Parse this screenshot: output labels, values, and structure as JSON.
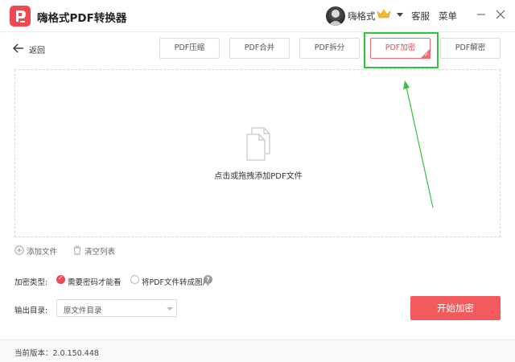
{
  "app": {
    "title": "嗨格式PDF转换器"
  },
  "header": {
    "user_name": "嗨格式",
    "service_label": "客服",
    "menu_label": "菜单",
    "minimize_icon": "minimize-icon",
    "close_icon": "close-icon"
  },
  "toolbar": {
    "back_label": "返回",
    "tabs": [
      {
        "label": "PDF压缩",
        "active": false
      },
      {
        "label": "PDF合并",
        "active": false
      },
      {
        "label": "PDF拆分",
        "active": false
      },
      {
        "label": "PDF加密",
        "active": true
      },
      {
        "label": "PDF解密",
        "active": false
      }
    ]
  },
  "dropzone": {
    "text": "点击或拖拽添加PDF文件"
  },
  "list_actions": {
    "add_file": "添加文件",
    "clear_list": "清空列表"
  },
  "encryption": {
    "label": "加密类型:",
    "options": [
      {
        "label": "需要密码才能看",
        "selected": true
      },
      {
        "label": "将PDF文件转成图片",
        "selected": false
      }
    ],
    "help": "?"
  },
  "output": {
    "label": "输出目录:",
    "value": "原文件目录"
  },
  "start_button": "开始加密",
  "footer": {
    "version": "当前版本：2.0.150.448"
  },
  "colors": {
    "accent": "#f04a50",
    "highlight": "#35c13c",
    "button": "#f25a5e"
  }
}
